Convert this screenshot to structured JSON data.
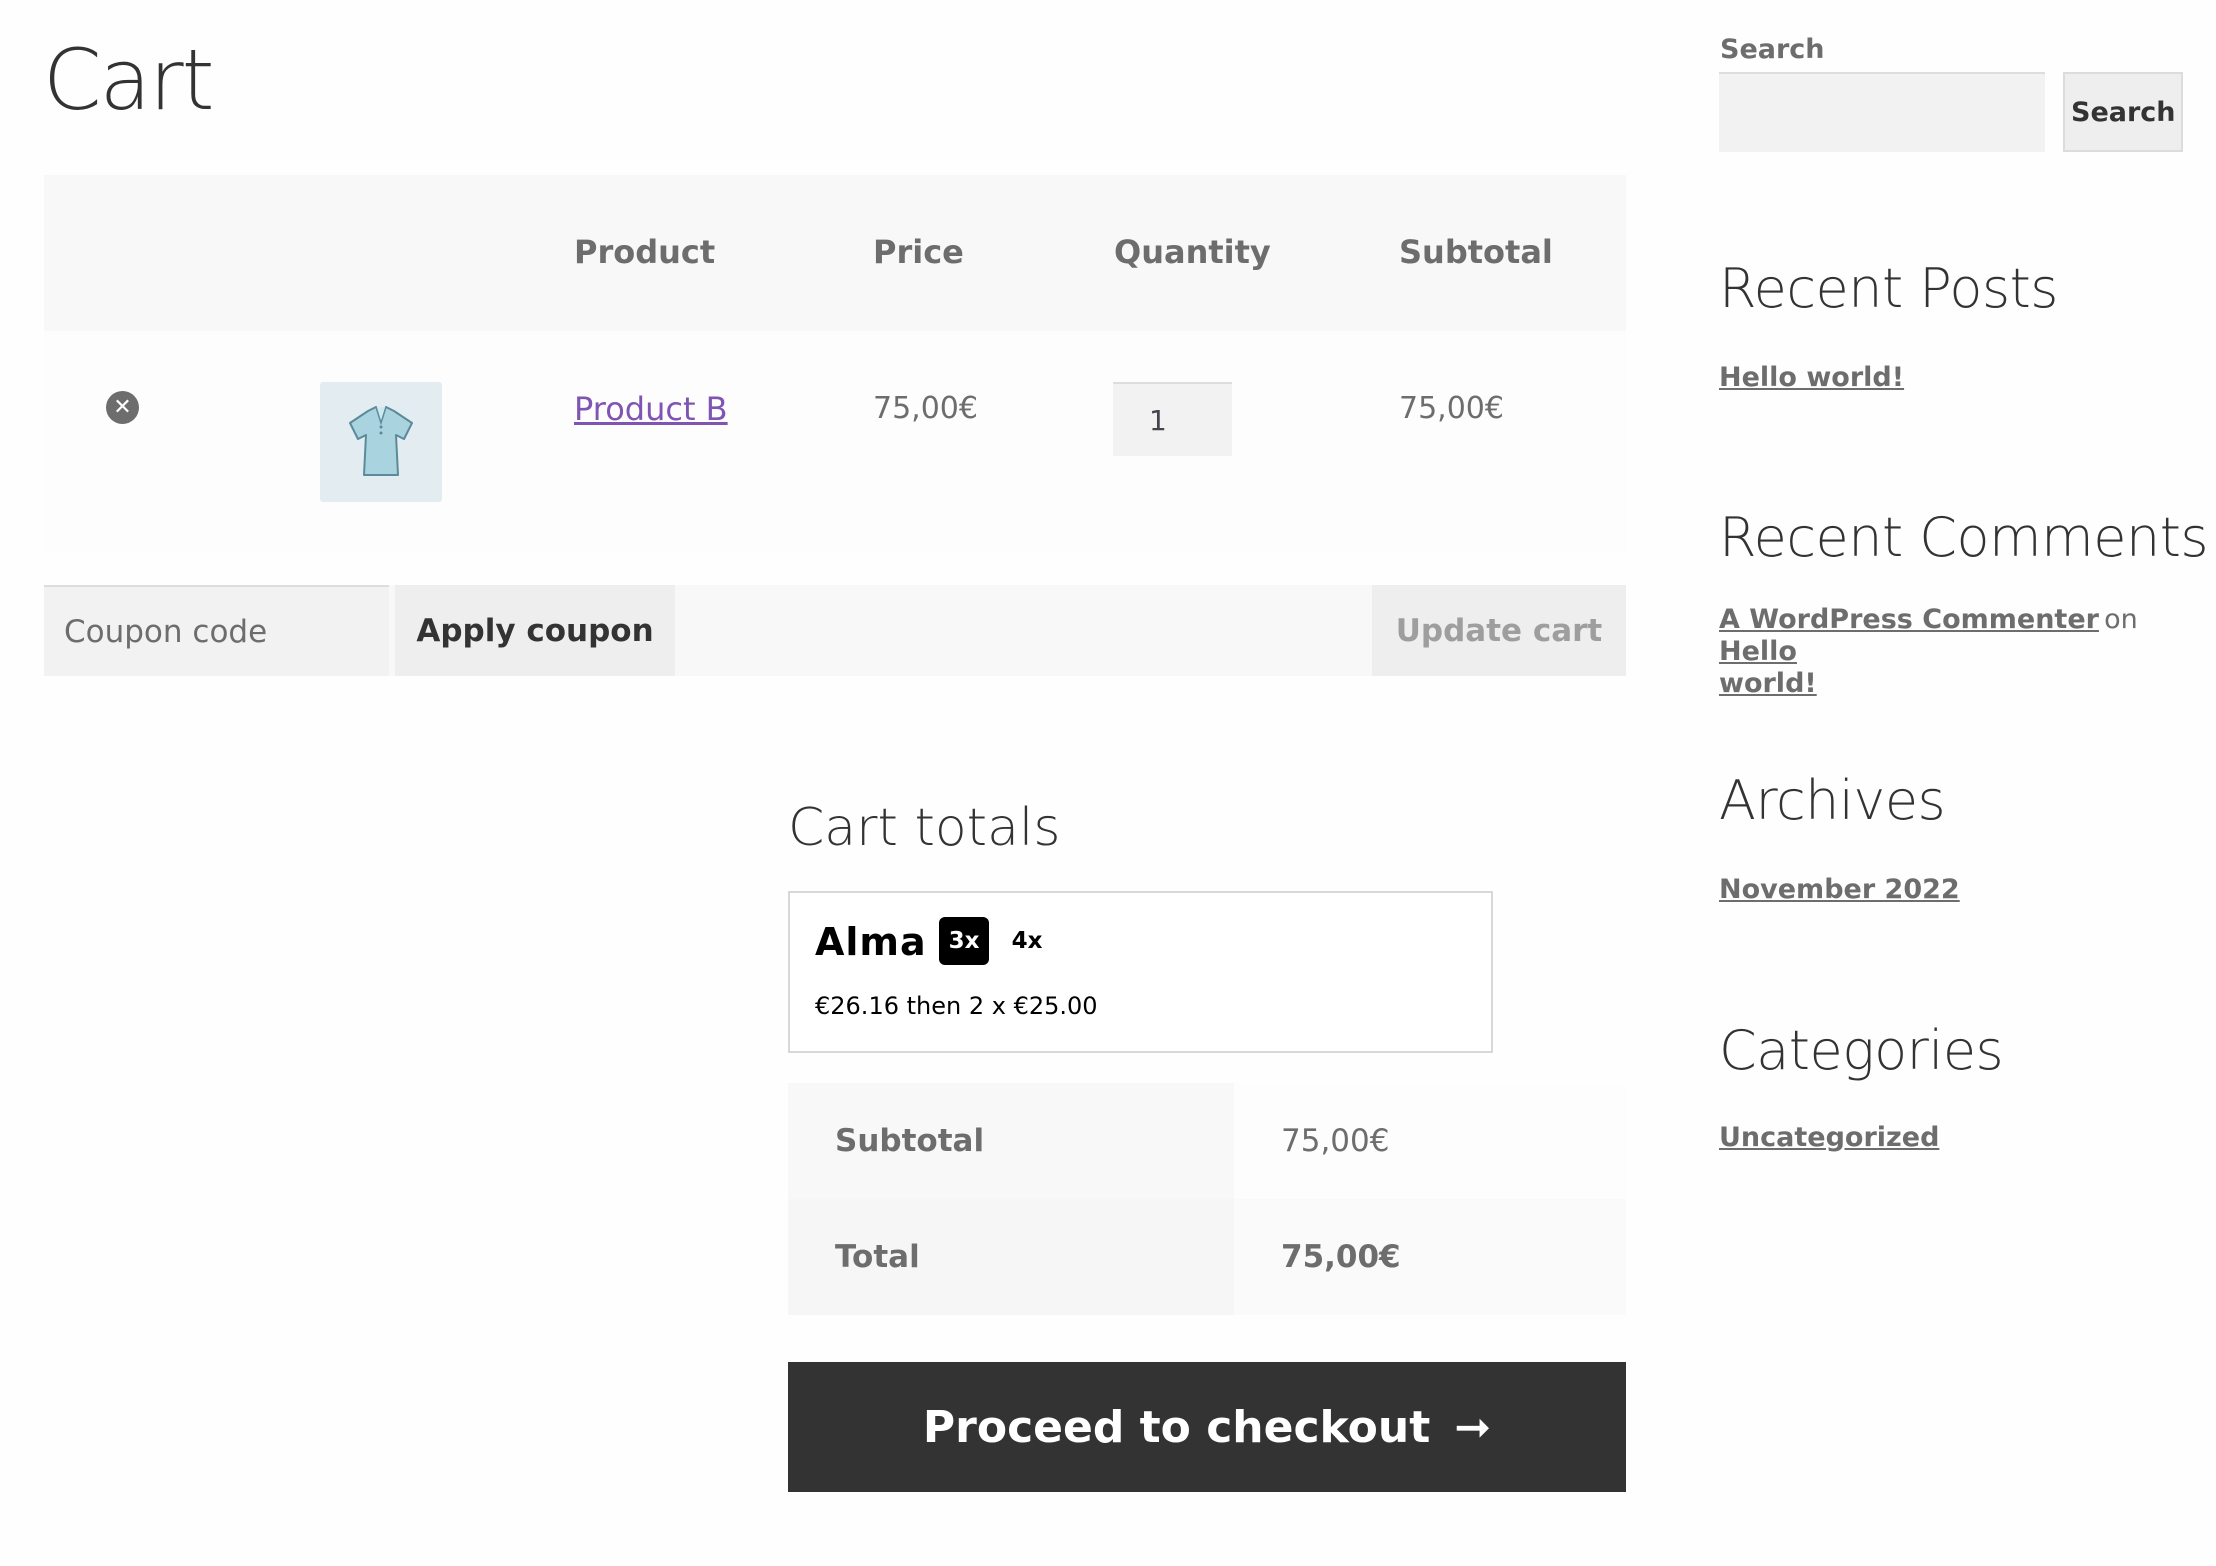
{
  "page": {
    "title": "Cart"
  },
  "cart_table": {
    "headers": {
      "product": "Product",
      "price": "Price",
      "quantity": "Quantity",
      "subtotal": "Subtotal"
    },
    "items": [
      {
        "remove_icon": "close-circle-icon",
        "thumbnail_icon": "polo-shirt-icon",
        "product_name": "Product B",
        "price": "75,00€",
        "quantity": "1",
        "subtotal": "75,00€"
      }
    ]
  },
  "actions": {
    "coupon_placeholder": "Coupon code",
    "apply_coupon_label": "Apply coupon",
    "update_cart_label": "Update cart"
  },
  "cart_totals": {
    "title": "Cart totals",
    "alma": {
      "logo_text": "Alma",
      "options": [
        "3x",
        "4x"
      ],
      "selected_option": "3x",
      "plan_text": "€26.16 then 2 x €25.00"
    },
    "rows": [
      {
        "label": "Subtotal",
        "value": "75,00€"
      },
      {
        "label": "Total",
        "value": "75,00€"
      }
    ],
    "checkout_label": "Proceed to checkout",
    "checkout_icon": "arrow-right-icon"
  },
  "sidebar": {
    "search": {
      "label": "Search",
      "button_label": "Search"
    },
    "recent_posts": {
      "title": "Recent Posts",
      "links": [
        "Hello world!"
      ]
    },
    "recent_comments": {
      "title": "Recent Comments",
      "author": "A WordPress Commenter",
      "connector": "on",
      "post_line1": "Hello",
      "post_line2": "world!"
    },
    "archives": {
      "title": "Archives",
      "links": [
        "November 2022"
      ]
    },
    "categories": {
      "title": "Categories",
      "links": [
        "Uncategorized"
      ]
    }
  },
  "colors": {
    "link_purple": "#7f54b3",
    "checkout_bg": "#333333",
    "text_gray": "#6d6d6d"
  }
}
